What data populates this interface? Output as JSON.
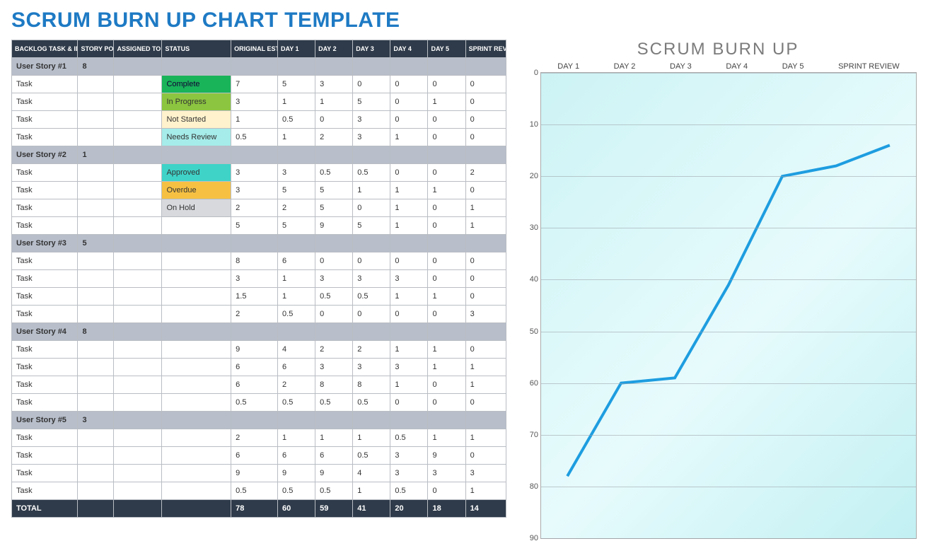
{
  "title": "SCRUM BURN UP CHART TEMPLATE",
  "columns": [
    "BACKLOG TASK & ID",
    "STORY POINTS",
    "ASSIGNED TO",
    "STATUS",
    "ORIGINAL ESTIMATE",
    "DAY 1",
    "DAY 2",
    "DAY 3",
    "DAY 4",
    "DAY 5",
    "SPRINT REVIEW"
  ],
  "status_styles": {
    "Complete": "status-complete",
    "In Progress": "status-inprogress",
    "Not Started": "status-notstarted",
    "Needs Review": "status-needsreview",
    "Approved": "status-approved",
    "Overdue": "status-overdue",
    "On Hold": "status-onhold"
  },
  "rows": [
    {
      "type": "story",
      "cells": [
        "User Story #1",
        "8",
        "",
        "",
        "",
        "",
        "",
        "",
        "",
        "",
        ""
      ]
    },
    {
      "type": "task",
      "cells": [
        "Task",
        "",
        "",
        "Complete",
        "7",
        "5",
        "3",
        "0",
        "0",
        "0",
        "0"
      ]
    },
    {
      "type": "task",
      "cells": [
        "Task",
        "",
        "",
        "In Progress",
        "3",
        "1",
        "1",
        "5",
        "0",
        "1",
        "0"
      ]
    },
    {
      "type": "task",
      "cells": [
        "Task",
        "",
        "",
        "Not Started",
        "1",
        "0.5",
        "0",
        "3",
        "0",
        "0",
        "0"
      ]
    },
    {
      "type": "task",
      "cells": [
        "Task",
        "",
        "",
        "Needs Review",
        "0.5",
        "1",
        "2",
        "3",
        "1",
        "0",
        "0"
      ]
    },
    {
      "type": "story",
      "cells": [
        "User Story #2",
        "1",
        "",
        "",
        "",
        "",
        "",
        "",
        "",
        "",
        ""
      ]
    },
    {
      "type": "task",
      "cells": [
        "Task",
        "",
        "",
        "Approved",
        "3",
        "3",
        "0.5",
        "0.5",
        "0",
        "0",
        "2"
      ]
    },
    {
      "type": "task",
      "cells": [
        "Task",
        "",
        "",
        "Overdue",
        "3",
        "5",
        "5",
        "1",
        "1",
        "1",
        "0"
      ]
    },
    {
      "type": "task",
      "cells": [
        "Task",
        "",
        "",
        "On Hold",
        "2",
        "2",
        "5",
        "0",
        "1",
        "0",
        "1"
      ]
    },
    {
      "type": "task",
      "cells": [
        "Task",
        "",
        "",
        "",
        "5",
        "5",
        "9",
        "5",
        "1",
        "0",
        "1"
      ]
    },
    {
      "type": "story",
      "cells": [
        "User Story #3",
        "5",
        "",
        "",
        "",
        "",
        "",
        "",
        "",
        "",
        ""
      ]
    },
    {
      "type": "task",
      "cells": [
        "Task",
        "",
        "",
        "",
        "8",
        "6",
        "0",
        "0",
        "0",
        "0",
        "0"
      ]
    },
    {
      "type": "task",
      "cells": [
        "Task",
        "",
        "",
        "",
        "3",
        "1",
        "3",
        "3",
        "3",
        "0",
        "0"
      ]
    },
    {
      "type": "task",
      "cells": [
        "Task",
        "",
        "",
        "",
        "1.5",
        "1",
        "0.5",
        "0.5",
        "1",
        "1",
        "0"
      ]
    },
    {
      "type": "task",
      "cells": [
        "Task",
        "",
        "",
        "",
        "2",
        "0.5",
        "0",
        "0",
        "0",
        "0",
        "3"
      ]
    },
    {
      "type": "story",
      "cells": [
        "User Story #4",
        "8",
        "",
        "",
        "",
        "",
        "",
        "",
        "",
        "",
        ""
      ]
    },
    {
      "type": "task",
      "cells": [
        "Task",
        "",
        "",
        "",
        "9",
        "4",
        "2",
        "2",
        "1",
        "1",
        "0"
      ]
    },
    {
      "type": "task",
      "cells": [
        "Task",
        "",
        "",
        "",
        "6",
        "6",
        "3",
        "3",
        "3",
        "1",
        "1"
      ]
    },
    {
      "type": "task",
      "cells": [
        "Task",
        "",
        "",
        "",
        "6",
        "2",
        "8",
        "8",
        "1",
        "0",
        "1"
      ]
    },
    {
      "type": "task",
      "cells": [
        "Task",
        "",
        "",
        "",
        "0.5",
        "0.5",
        "0.5",
        "0.5",
        "0",
        "0",
        "0"
      ]
    },
    {
      "type": "story",
      "cells": [
        "User Story #5",
        "3",
        "",
        "",
        "",
        "",
        "",
        "",
        "",
        "",
        ""
      ]
    },
    {
      "type": "task",
      "cells": [
        "Task",
        "",
        "",
        "",
        "2",
        "1",
        "1",
        "1",
        "0.5",
        "1",
        "1"
      ]
    },
    {
      "type": "task",
      "cells": [
        "Task",
        "",
        "",
        "",
        "6",
        "6",
        "6",
        "0.5",
        "3",
        "9",
        "0"
      ]
    },
    {
      "type": "task",
      "cells": [
        "Task",
        "",
        "",
        "",
        "9",
        "9",
        "9",
        "4",
        "3",
        "3",
        "3"
      ]
    },
    {
      "type": "task",
      "cells": [
        "Task",
        "",
        "",
        "",
        "0.5",
        "0.5",
        "0.5",
        "1",
        "0.5",
        "0",
        "1"
      ]
    },
    {
      "type": "total",
      "cells": [
        "TOTAL",
        "",
        "",
        "",
        "78",
        "60",
        "59",
        "41",
        "20",
        "18",
        "14"
      ]
    }
  ],
  "chart_data": {
    "type": "line",
    "title": "SCRUM BURN UP",
    "categories": [
      "DAY 1",
      "DAY 2",
      "DAY 3",
      "DAY 4",
      "DAY 5",
      "SPRINT REVIEW"
    ],
    "values": [
      78,
      60,
      59,
      41,
      20,
      18,
      14
    ],
    "ylim": [
      0,
      90
    ],
    "y_ticks": [
      0,
      10,
      20,
      30,
      40,
      50,
      60,
      70,
      80,
      90
    ],
    "y_reversed": true,
    "line_color": "#1e9de0",
    "grid": true
  }
}
